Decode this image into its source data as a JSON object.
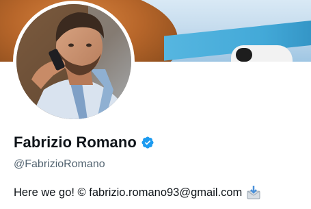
{
  "profile": {
    "display_name": "Fabrizio Romano",
    "handle": "@FabrizioRomano",
    "verified": true,
    "bio": "Here we go! © fabrizio.romano93@gmail.com",
    "bio_emoji_icon": "incoming-envelope-icon"
  },
  "colors": {
    "verified_blue": "#1d9bf0",
    "name_text": "#0f1419",
    "handle_text": "#536471"
  }
}
